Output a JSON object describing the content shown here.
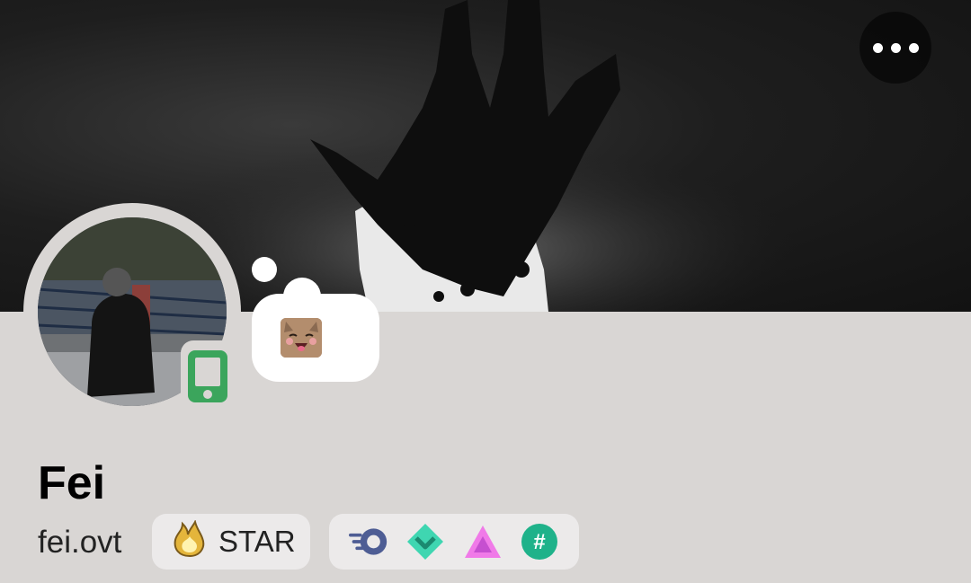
{
  "profile": {
    "display_name": "Fei",
    "username": "fei.ovt",
    "status": "mobile"
  },
  "header": {
    "more_icon": "more-horizontal-icon"
  },
  "custom_status": {
    "emoji": "cat-laughing-emoji"
  },
  "guild_tag": {
    "label": "STAR",
    "icon": "flame-badge-icon"
  },
  "badges": [
    {
      "name": "hypesquad-speed-badge"
    },
    {
      "name": "chevron-down-gem-badge"
    },
    {
      "name": "pink-triangle-badge"
    },
    {
      "name": "hashtag-badge"
    }
  ],
  "colors": {
    "background": "#d9d6d4",
    "status_online": "#3ba55c",
    "pill": "#eceaea"
  }
}
